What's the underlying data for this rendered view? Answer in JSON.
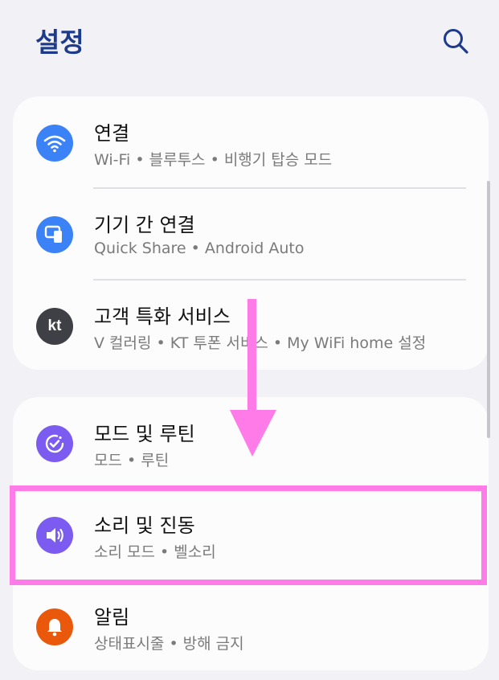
{
  "header": {
    "title": "설정",
    "search_icon": "search-icon"
  },
  "colors": {
    "title": "#1e3a8a",
    "wifi": "#3b82f6",
    "device": "#3b82f6",
    "kt": "#3f3f46",
    "modes": "#7c5cf0",
    "sound": "#7c5cf0",
    "notif": "#ea580c",
    "annotation": "#ff7be8"
  },
  "items": [
    {
      "label": "연결",
      "sub": "Wi-Fi • 블루투스 • 비행기 탑승 모드",
      "icon": "wifi-icon"
    },
    {
      "label": "기기 간 연결",
      "sub": "Quick Share • Android Auto",
      "icon": "device-link-icon"
    },
    {
      "label": "고객 특화 서비스",
      "sub": "V 컬러링 • KT 투폰 서비스 • My WiFi home 설정",
      "icon": "kt-icon",
      "icon_text": "kt"
    },
    {
      "label": "모드 및 루틴",
      "sub": "모드 • 루틴",
      "icon": "modes-routines-icon"
    },
    {
      "label": "소리 및 진동",
      "sub": "소리 모드 • 벨소리",
      "icon": "speaker-icon"
    },
    {
      "label": "알림",
      "sub": "상태표시줄 • 방해 금지",
      "icon": "bell-icon"
    }
  ]
}
